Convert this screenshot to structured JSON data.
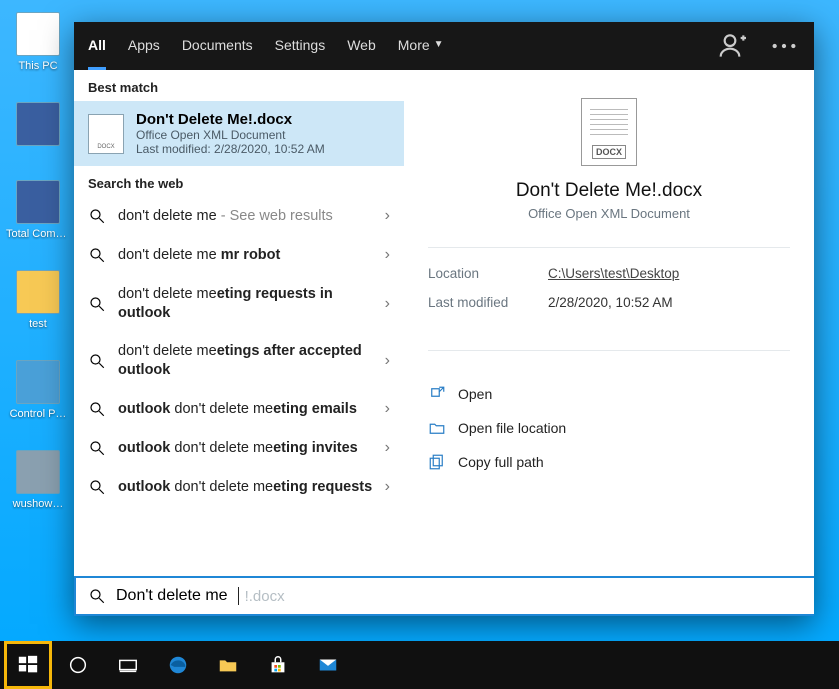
{
  "desktop_icons": [
    {
      "label": "This PC"
    },
    {
      "label": ""
    },
    {
      "label": "Total Comma…"
    },
    {
      "label": "test"
    },
    {
      "label": "Control P…"
    },
    {
      "label": "wushow…"
    }
  ],
  "header": {
    "tabs": [
      "All",
      "Apps",
      "Documents",
      "Settings",
      "Web",
      "More"
    ]
  },
  "left": {
    "best_match_label": "Best match",
    "best": {
      "title": "Don't Delete Me!.docx",
      "subtitle": "Office Open XML Document",
      "modified": "Last modified: 2/28/2020, 10:52 AM"
    },
    "web_label": "Search the web",
    "web": [
      {
        "pre": "don't delete me",
        "bold": "",
        "suffix": " - See web results",
        "hint": true
      },
      {
        "pre": "don't delete me ",
        "bold": "mr robot"
      },
      {
        "pre": "don't delete me",
        "bold": "eting requests in outlook"
      },
      {
        "pre": "don't delete me",
        "bold": "etings after accepted outlook"
      },
      {
        "pre": "",
        "bold": "outlook",
        "mid": " don't delete me",
        "bold2": "eting emails"
      },
      {
        "pre": "",
        "bold": "outlook",
        "mid": " don't delete me",
        "bold2": "eting invites"
      },
      {
        "pre": "",
        "bold": "outlook",
        "mid": " don't delete me",
        "bold2": "eting requests"
      }
    ]
  },
  "right": {
    "title": "Don't Delete Me!.docx",
    "subtitle": "Office Open XML Document",
    "location_label": "Location",
    "location_value": "C:\\Users\\test\\Desktop",
    "modified_label": "Last modified",
    "modified_value": "2/28/2020, 10:52 AM",
    "actions": [
      "Open",
      "Open file location",
      "Copy full path"
    ]
  },
  "search": {
    "typed": "Don't delete me",
    "ghost": "!.docx"
  },
  "doc_badge": "DOCX"
}
